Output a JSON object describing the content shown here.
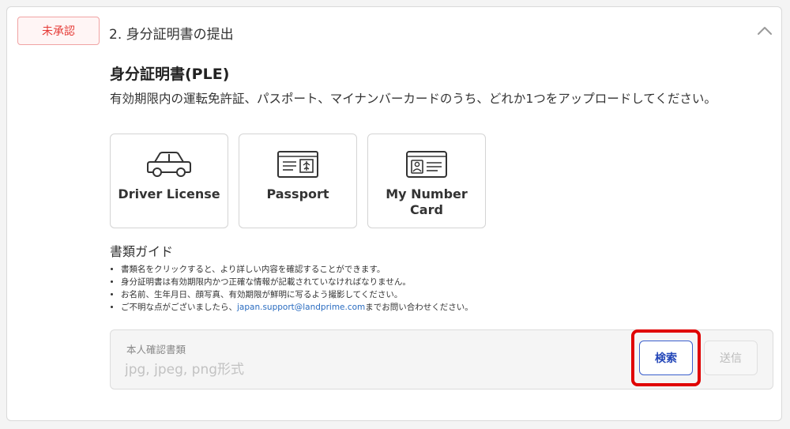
{
  "header": {
    "status_badge": "未承認",
    "section_title": "2. 身分証明書の提出"
  },
  "document": {
    "title": "身分証明書(PLE)",
    "description": "有効期限内の運転免許証、パスポート、マイナンバーカードのうち、どれか1つをアップロードしてください。"
  },
  "doc_types": [
    {
      "label": "Driver License",
      "icon": "car-icon"
    },
    {
      "label": "Passport",
      "icon": "passport-icon"
    },
    {
      "label": "My Number Card",
      "icon": "id-card-icon"
    }
  ],
  "guide": {
    "title": "書類ガイド",
    "items": [
      "書類名をクリックすると、より詳しい内容を確認することができます。",
      "身分証明書は有効期限内かつ正確な情報が記載されていなければなりません。",
      "お名前、生年月日、顔写真、有効期限が鮮明に写るよう撮影してください。"
    ],
    "contact_prefix": "ご不明な点がございましたら、",
    "contact_email": "japan.support@landprime.com",
    "contact_suffix": "までお問い合わせください。"
  },
  "upload": {
    "label": "本人確認書類",
    "placeholder": "jpg, jpeg, png形式",
    "search_label": "検索",
    "submit_label": "送信"
  },
  "colors": {
    "badge_red": "#e53935",
    "accent_blue": "#2346b8",
    "highlight_red": "#e00000",
    "link_blue": "#2a6cc0"
  }
}
